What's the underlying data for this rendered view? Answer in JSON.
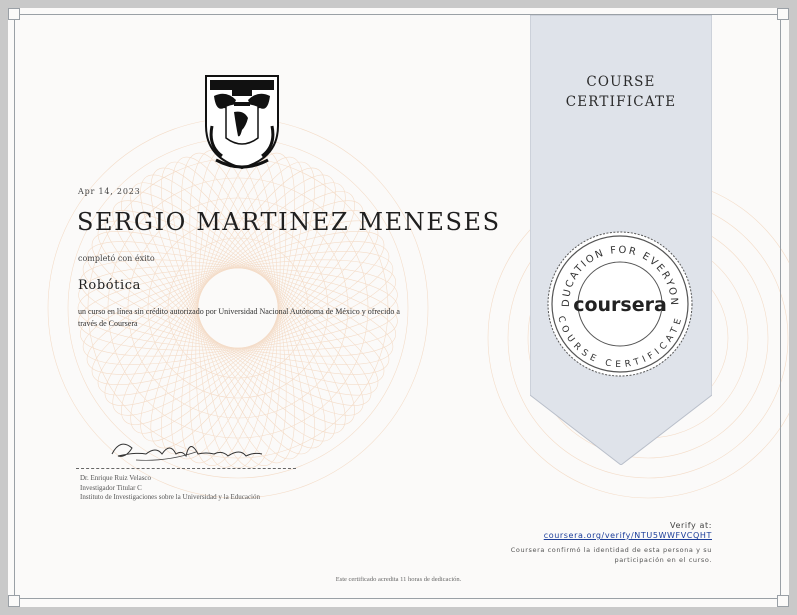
{
  "certificate": {
    "date": "Apr 14, 2023",
    "recipient_name": "SERGIO MARTINEZ MENESES",
    "completed_text": "completó con éxito",
    "course_name": "Robótica",
    "description": "un curso en línea sin crédito autorizado por Universidad Nacional Autónoma de México y ofrecido a través de Coursera",
    "footer": "Este certificado acredita 11 horas de dedicación."
  },
  "institution": {
    "seal_top_text": "UNIVERSIDAD NACIONAL AUTONOMA DE MEXICO",
    "seal_motto": "POR MI RAZA HABLARA EL ESPIRITU"
  },
  "signatory": {
    "signature_text": "Enrique Ruiz Velasco Sánchez",
    "name": "Dr. Enrique Ruiz Velasco",
    "title": "Investigador Titular C",
    "institute": "Instituto de Investigaciones sobre la Universidad y la Educación"
  },
  "ribbon": {
    "title_line1": "COURSE",
    "title_line2": "CERTIFICATE",
    "badge_top_text": "EDUCATION FOR EVERYONE",
    "badge_bottom_text": "COURSE CERTIFICATE",
    "badge_logo": "coursera"
  },
  "verification": {
    "label": "Verify at:",
    "link": "coursera.org/verify/NTU5WWFVCQHT",
    "note": "Coursera confirmó la identidad de esta persona y su participación en el curso."
  },
  "colors": {
    "ribbon": "#dfe3ea",
    "ribbon_border": "#b9bfca",
    "link": "#1b3d9a",
    "guilloche": "#f3d9c3"
  }
}
